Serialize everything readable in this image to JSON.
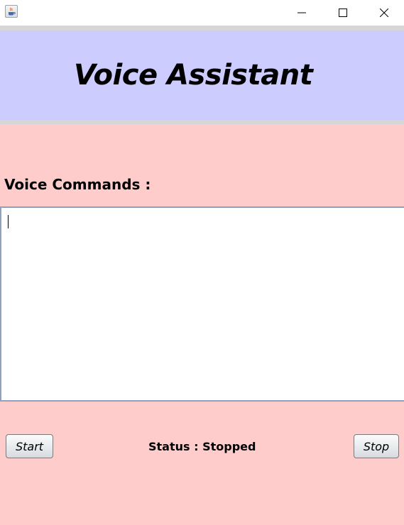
{
  "window": {
    "app_icon": "java-icon",
    "controls": [
      "minimize-icon",
      "maximize-icon",
      "close-icon"
    ]
  },
  "header": {
    "title": "Voice Assistant",
    "background": "#ccccff"
  },
  "main": {
    "background": "#ffcccc",
    "commands_label": "Voice Commands :",
    "commands_text": ""
  },
  "footer": {
    "start_label": "Start",
    "status_text": "Status : Stopped",
    "stop_label": "Stop"
  }
}
